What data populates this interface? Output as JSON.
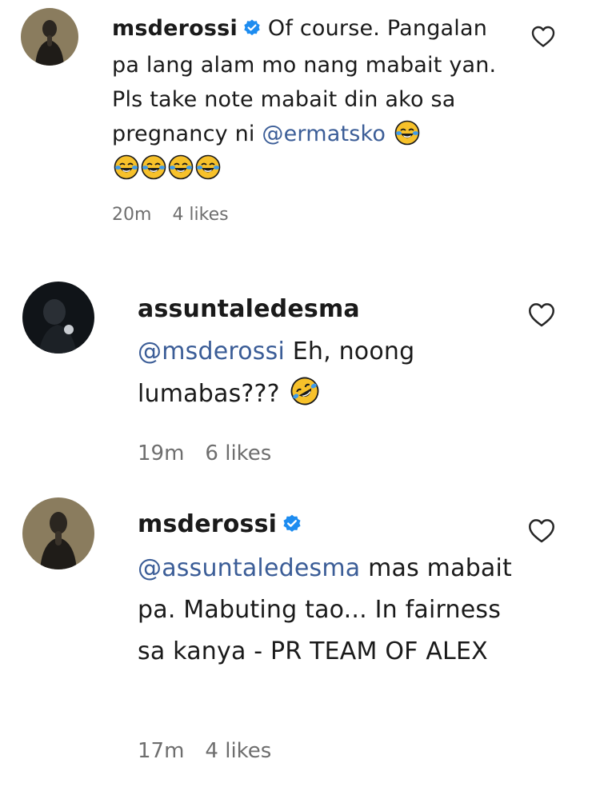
{
  "comments": [
    {
      "username": "msderossi",
      "verified": true,
      "avatar_icon": "woman-praying-hands-avatar",
      "text_before": "Of course. Pangalan pa lang alam mo nang mabait yan. Pls take note mabait din ako sa pregnancy ni",
      "mention": "@ermatsko",
      "text_after": "",
      "emojis": [
        "face-with-tears-of-joy",
        "face-with-tears-of-joy",
        "face-with-tears-of-joy",
        "face-with-tears-of-joy",
        "face-with-tears-of-joy"
      ],
      "time": "20m",
      "likes": "4 likes"
    },
    {
      "username": "assuntaledesma",
      "verified": false,
      "avatar_icon": "dark-portrait-avatar",
      "mention": "@msderossi",
      "text_after": "Eh, noong lumabas???",
      "emojis": [
        "rolling-on-the-floor-laughing"
      ],
      "time": "19m",
      "likes": "6 likes"
    },
    {
      "username": "msderossi",
      "verified": true,
      "avatar_icon": "woman-praying-hands-avatar",
      "mention": "@assuntaledesma",
      "text_after": "mas mabait pa. Mabuting tao... In fairness sa kanya - PR TEAM OF ALEX",
      "emojis": [],
      "time": "17m",
      "likes": "4 likes"
    }
  ],
  "colors": {
    "mention": "#3b5d97",
    "verified": "#1d8cf0",
    "meta": "#6e6e6e",
    "text": "#1a1a1a"
  },
  "icons": {
    "like": "heart-outline-icon",
    "verified": "verified-badge-icon"
  }
}
